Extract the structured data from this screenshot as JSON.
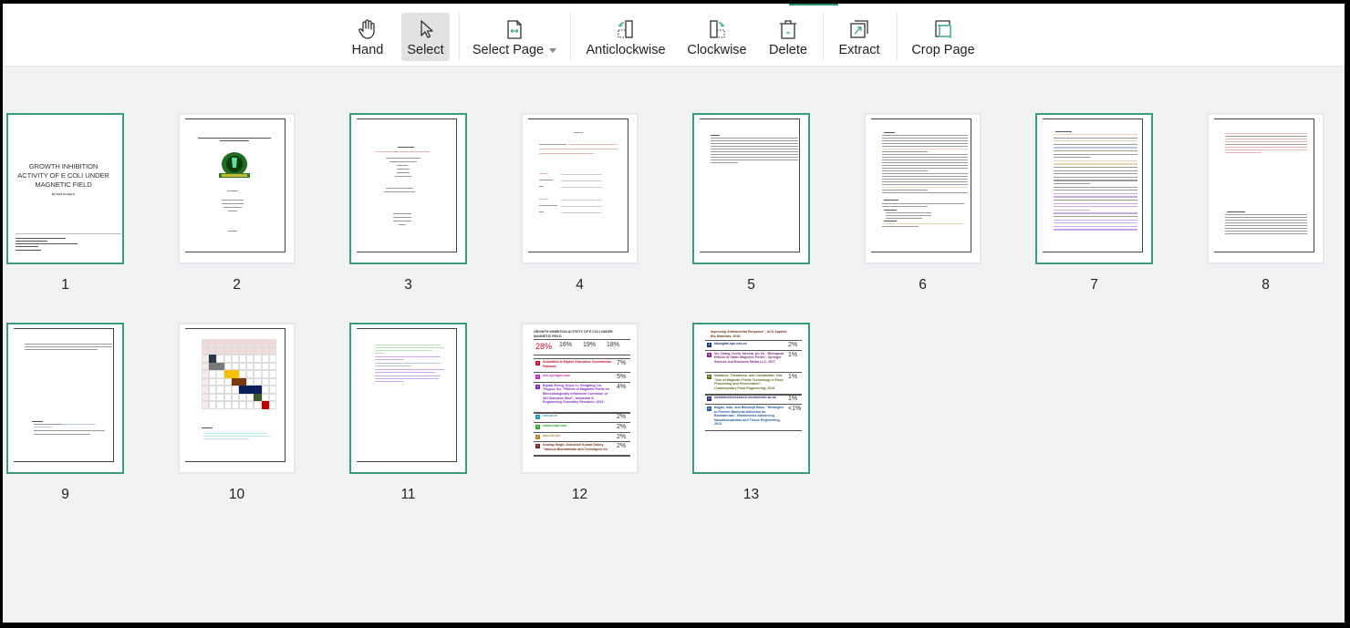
{
  "toolbar": {
    "tools": [
      {
        "id": "hand",
        "label": "Hand",
        "icon": "hand-icon",
        "active": false
      },
      {
        "id": "select",
        "label": "Select",
        "icon": "cursor-arrow-icon",
        "active": true
      },
      {
        "id": "select-page",
        "label": "Select Page",
        "icon": "page-width-icon",
        "has_dropdown": true
      },
      {
        "id": "anticlockwise",
        "label": "Anticlockwise",
        "icon": "rotate-anticlockwise-icon"
      },
      {
        "id": "clockwise",
        "label": "Clockwise",
        "icon": "rotate-clockwise-icon"
      },
      {
        "id": "delete",
        "label": "Delete",
        "icon": "trash-icon"
      },
      {
        "id": "extract",
        "label": "Extract",
        "icon": "extract-icon"
      },
      {
        "id": "crop-page",
        "label": "Crop Page",
        "icon": "crop-icon"
      }
    ],
    "accent_color": "#2f8f6f"
  },
  "pages": [
    {
      "number": "1",
      "selected": true,
      "kind": "cover",
      "title": "GROWTH INHIBITION ACTIVITY OF E COLI UNDER MAGNETIC FIELD",
      "byline": "By Abid Arshad A"
    },
    {
      "number": "2",
      "selected": false,
      "kind": "title-logo",
      "title": "GROWTH INHIBITION ACTIVITY OF E COLI UNDER MAGNETIC FIELD"
    },
    {
      "number": "3",
      "selected": true,
      "kind": "title-text",
      "title": "Research proposal"
    },
    {
      "number": "4",
      "selected": false,
      "kind": "approval",
      "title": "Approval"
    },
    {
      "number": "5",
      "selected": true,
      "kind": "abstract",
      "title": "Abstract"
    },
    {
      "number": "6",
      "selected": false,
      "kind": "introduction",
      "title": "1. Introduction"
    },
    {
      "number": "7",
      "selected": true,
      "kind": "literature",
      "title": "2. Literature Review"
    },
    {
      "number": "8",
      "selected": false,
      "kind": "methodology",
      "title": "3. Research Methodology"
    },
    {
      "number": "9",
      "selected": true,
      "kind": "plan",
      "title": "Plan of study"
    },
    {
      "number": "10",
      "selected": false,
      "kind": "gantt",
      "title": "References"
    },
    {
      "number": "11",
      "selected": true,
      "kind": "references"
    },
    {
      "number": "12",
      "selected": false,
      "kind": "originality-report",
      "title": "GROWTH INHIBITION ACTIVITY OF E COLI UNDER MAGNETIC FIELD",
      "scores": [
        "28%",
        "16%",
        "19%",
        "18%"
      ],
      "sources": [
        {
          "n": "1",
          "text": "Submitted to Higher Education Commission Pakistan",
          "pct": "7%",
          "color": "#c8102e"
        },
        {
          "n": "2",
          "text": "link.springer.com",
          "pct": "5%",
          "color": "#c42bb8"
        },
        {
          "n": "3",
          "text": "Bijuan Zheng, Kejun Li, Hongfang Liu, Tingyue Gu. \"Effects of Magnetic Fields on Microbiologically Influenced Corrosion of 304 Stainless Steel\", Industrial & Engineering Chemistry Research, 2013",
          "pct": "4%",
          "color": "#7a2bc4"
        },
        {
          "n": "4",
          "text": "cnri.ac.in",
          "pct": "2%",
          "color": "#1b9aaa"
        },
        {
          "n": "5",
          "text": "www.mdpi.com",
          "pct": "2%",
          "color": "#2ba82b"
        },
        {
          "n": "6",
          "text": "nlm.nih.net",
          "pct": "2%",
          "color": "#b5832b"
        },
        {
          "n": "7",
          "text": "Anurag Singh, Ashutosh Kumar Dubey. \"Various Biomaterials and Techniques for",
          "pct": "2%",
          "color": "#7a2b1b"
        }
      ]
    },
    {
      "number": "13",
      "selected": true,
      "kind": "originality-report-2",
      "head": "Improving Antibacterial Response\", ACS Applied Bio Materials, 2018",
      "sources": [
        {
          "n": "8",
          "text": "bibdigital.epn.edu.ec",
          "pct": "2%",
          "color": "#1b3a6b"
        },
        {
          "n": "9",
          "text": "Xin Zhang, Kevin Yarema, An Xu. \"Biological Effects of Static Magnetic Fields\", Springer Science and Business Media LLC, 2017",
          "pct": "1%",
          "color": "#8a2b8a"
        },
        {
          "n": "10",
          "text": "Vasiakos, Theodoros, and Constantine Tzia. \"Use of Magnetic Fields Technology in Food Processing and Preservation\", Contemporary Food Engineering, 2015.",
          "pct": "1%",
          "color": "#5a6b1b"
        },
        {
          "n": "11",
          "text": "westminsterresearch.westminster.ac.uk",
          "pct": "1%",
          "color": "#2b2b7a"
        },
        {
          "n": "12",
          "text": "Bajpai, Indu, and Bikramjit Basu. \"Strategies to Prevent Bacterial Adhesion on Biomaterials\", Biomimetics Advancing Nanobiomaterials and Tissue Engineering, 2013.",
          "pct": "<1%",
          "color": "#1b5a9a"
        }
      ]
    }
  ]
}
